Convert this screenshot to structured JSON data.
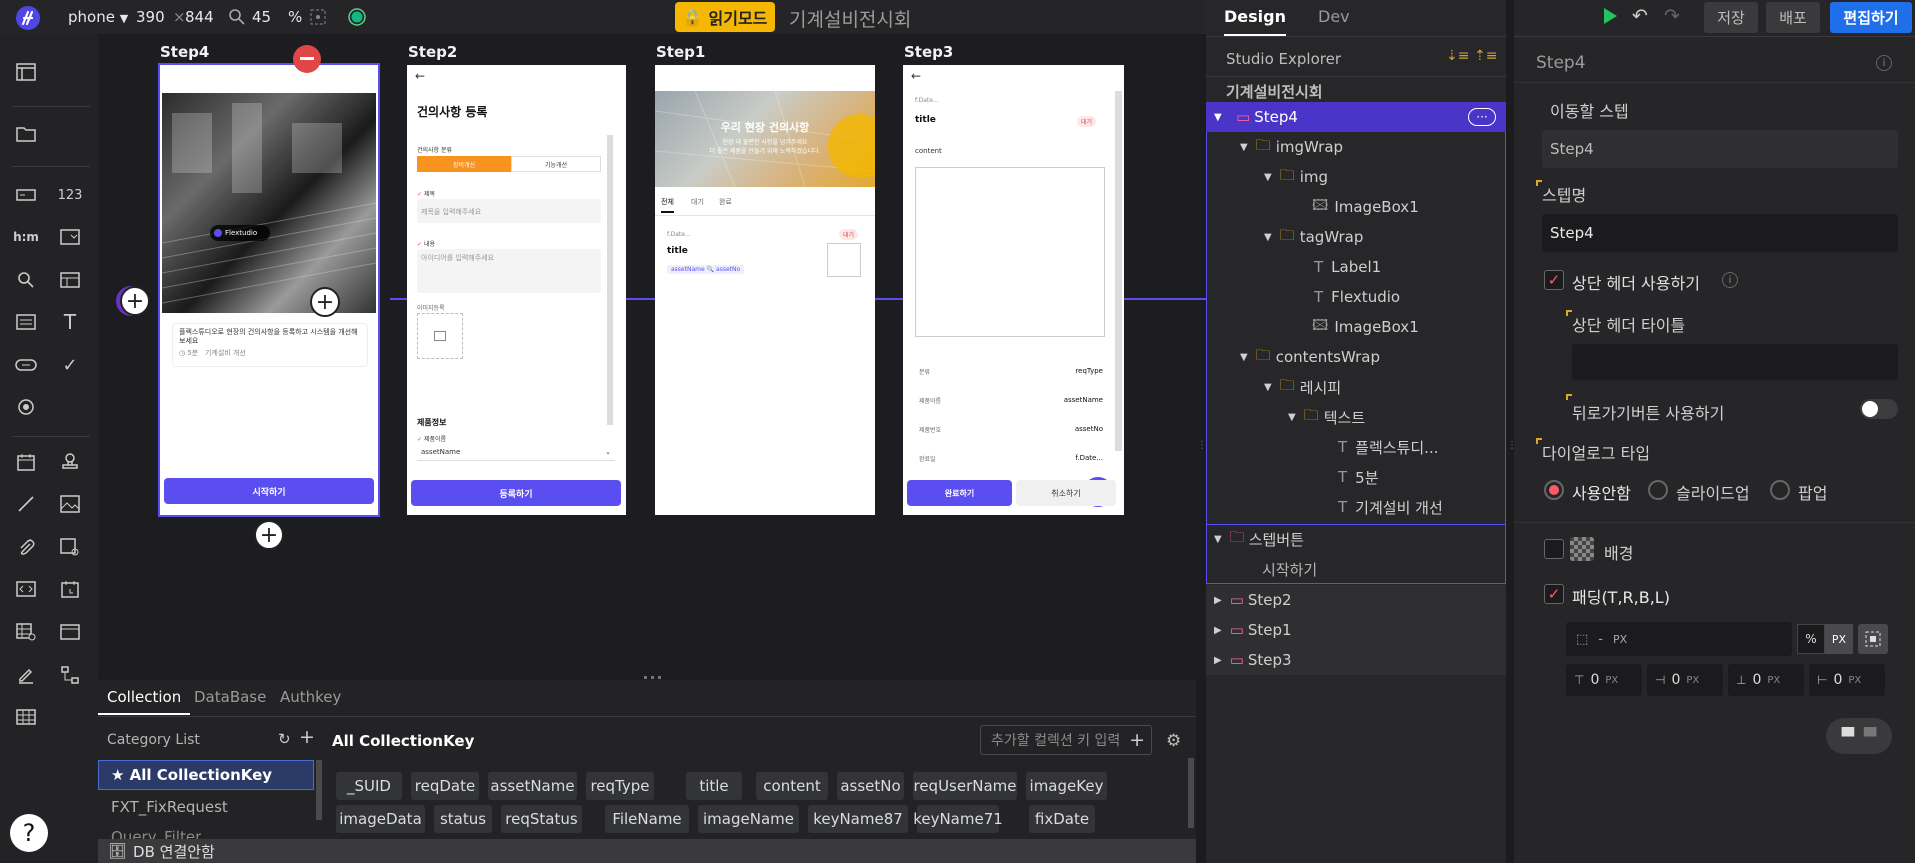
{
  "topbar": {
    "device": "phone",
    "width": "390",
    "times": "×",
    "height": "844",
    "zoom": "45",
    "zoom_unit": "%",
    "readmode_label": "읽기모드",
    "app_title": "기계설비전시회"
  },
  "design_tabs": {
    "design": "Design",
    "dev": "Dev"
  },
  "actions": {
    "save": "저장",
    "deploy": "배포",
    "edit": "편집하기"
  },
  "steps": {
    "step4": {
      "label": "Step4",
      "brand": "Flextudio",
      "card_text": "플렉스튜디오로 현장의 건의사항을 등록하고 시스템을 개선해보세요",
      "card_time": "5분",
      "card_tag": "기계설비 개선",
      "button": "시작하기"
    },
    "step2": {
      "label": "Step2",
      "title": "건의사항 등록",
      "category_label": "건의사항 분류",
      "seg1": "장비개선",
      "seg2": "기능개선",
      "subject_label": "제목",
      "subject_ph": "제목을 입력해주세요",
      "content_label": "내용",
      "content_ph": "아이디어를 입력해주세요",
      "image_label": "이미지등록",
      "product_info": "제품정보",
      "product_name_label": "제품이름",
      "product_name_value": "assetName",
      "button": "등록하기"
    },
    "step1": {
      "label": "Step1",
      "hero_title": "우리 현장 건의사항",
      "hero_sub1": "현장 내 불편한 사항을 남겨주세요",
      "hero_sub2": "더 좋은 제품을 만들기 위해 노력하겠습니다.",
      "tab_all": "전체",
      "tab_wait": "대기",
      "tab_done": "완료",
      "item_date": "f.Date...",
      "item_badge": "대기",
      "item_title": "title",
      "item_asset": "assetName",
      "item_assetno": "assetNo"
    },
    "step3": {
      "label": "Step3",
      "date": "f.Date...",
      "badge": "대기",
      "title": "title",
      "content": "content",
      "rows": [
        {
          "k": "분류",
          "v": "reqType"
        },
        {
          "k": "제품이름",
          "v": "assetName"
        },
        {
          "k": "제품번호",
          "v": "assetNo"
        },
        {
          "k": "완료일",
          "v": "f.Date..."
        }
      ],
      "btn_done": "완료하기",
      "btn_cancel": "취소하기"
    }
  },
  "bottom": {
    "tabs": [
      "Collection",
      "DataBase",
      "Authkey"
    ],
    "category_title": "Category List",
    "categories": [
      "★ All CollectionKey",
      "FXT_FixRequest",
      "Query_Filter"
    ],
    "collection_title": "All CollectionKey",
    "add_placeholder": "추가할 컬렉션 키 입력",
    "keys_row1": [
      "_SUID",
      "reqDate",
      "assetName",
      "reqType",
      "title",
      "content",
      "assetNo",
      "reqUserName",
      "imageKey"
    ],
    "keys_row2": [
      "imageData",
      "status",
      "reqStatus",
      "FileName",
      "imageName",
      "keyName87",
      "keyName71",
      "fixDate"
    ],
    "db_status": "DB 연결안함"
  },
  "explorer": {
    "title": "Studio Explorer",
    "project": "기계설비전시회",
    "tree": [
      {
        "label": "Step4",
        "icon": "page-icon"
      },
      {
        "label": "imgWrap",
        "icon": "folder-icon"
      },
      {
        "label": "img",
        "icon": "folder-icon"
      },
      {
        "label": "ImageBox1",
        "icon": "image-icon"
      },
      {
        "label": "tagWrap",
        "icon": "folder-icon"
      },
      {
        "label": "Label1",
        "icon": "text-icon"
      },
      {
        "label": "Flextudio",
        "icon": "text-icon"
      },
      {
        "label": "ImageBox1",
        "icon": "image-icon"
      },
      {
        "label": "contentsWrap",
        "icon": "folder-icon"
      },
      {
        "label": "레시피",
        "icon": "folder-icon"
      },
      {
        "label": "텍스트",
        "icon": "folder-icon"
      },
      {
        "label": "플렉스튜디...",
        "icon": "text-icon"
      },
      {
        "label": "5분",
        "icon": "text-icon"
      },
      {
        "label": "기계설비 개선",
        "icon": "text-icon"
      },
      {
        "label": "스텝버튼",
        "icon": "page-icon"
      },
      {
        "label": "시작하기",
        "icon": "none"
      },
      {
        "label": "Step2",
        "icon": "page-icon"
      },
      {
        "label": "Step1",
        "icon": "page-icon"
      },
      {
        "label": "Step3",
        "icon": "page-icon"
      }
    ]
  },
  "props": {
    "title": "Step4",
    "move_step_label": "이동할 스텝",
    "move_step_value": "Step4",
    "step_name_label": "스텝명",
    "step_name_value": "Step4",
    "use_header_label": "상단 헤더 사용하기",
    "header_title_label": "상단 헤더 타이틀",
    "header_title_value": "",
    "back_button_label": "뒤로가기버튼 사용하기",
    "dialog_type_label": "다이얼로그 타입",
    "dialog_options": [
      "사용안함",
      "슬라이드업",
      "팝업"
    ],
    "background_label": "배경",
    "padding_label": "패딩(T,R,B,L)",
    "padding_all": "-",
    "unit_px": "PX",
    "unit_pct": "%",
    "pad_values": [
      "0",
      "0",
      "0",
      "0"
    ]
  },
  "colors": {
    "accent": "#5b4ef0",
    "readmode": "#f5b701",
    "primary_button": "#1f6feb"
  }
}
